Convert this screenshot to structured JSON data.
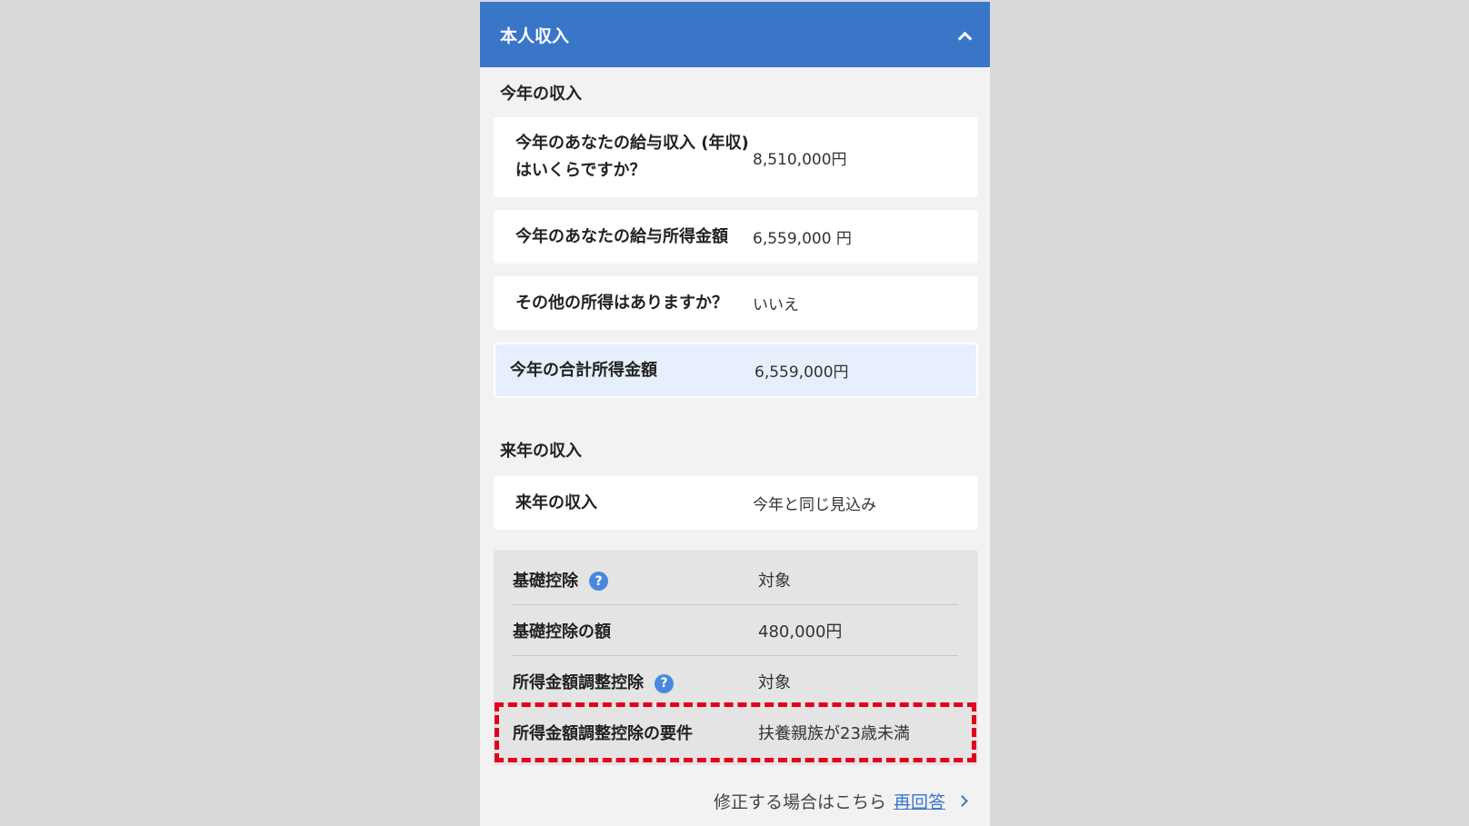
{
  "header": {
    "title": "本人収入"
  },
  "this_year": {
    "section_title": "今年の収入",
    "rows": [
      {
        "question": "今年のあなたの給与収入 (年収) はいくらですか？",
        "answer": "8,510,000円"
      },
      {
        "question": "今年のあなたの給与所得金額",
        "answer": "6,559,000 円"
      },
      {
        "question": "その他の所得はありますか？",
        "answer": "いいえ"
      }
    ],
    "total": {
      "label": "今年の合計所得金額",
      "value": "6,559,000円"
    }
  },
  "next_year": {
    "section_title": "来年の収入",
    "row": {
      "question": "来年の収入",
      "answer": "今年と同じ見込み"
    }
  },
  "summary": {
    "rows": [
      {
        "label": "基礎控除",
        "value": "対象",
        "help": "?"
      },
      {
        "label": "基礎控除の額",
        "value": "480,000円"
      },
      {
        "label": "所得金額調整控除",
        "value": "対象",
        "help": "?"
      },
      {
        "label": "所得金額調整控除の要件",
        "value": "扶養親族が23歳未満"
      }
    ]
  },
  "footer": {
    "text": "修正する場合はこちら",
    "link": "再回答"
  },
  "colors": {
    "header": "#3a76c8",
    "highlight": "#e2001a"
  }
}
